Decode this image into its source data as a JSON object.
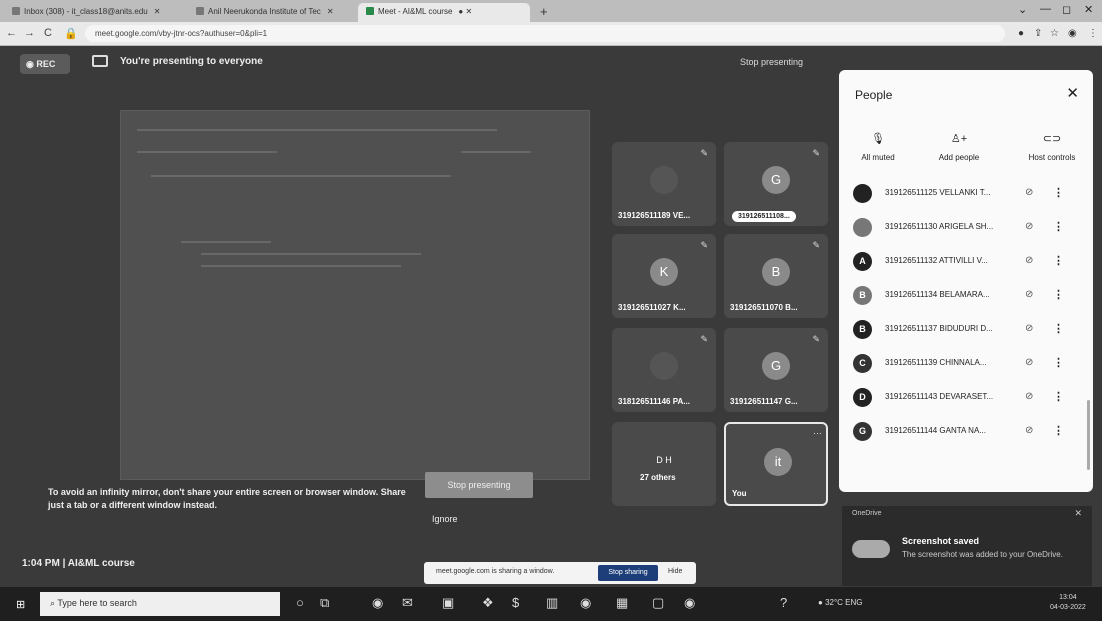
{
  "browser": {
    "tabs": [
      {
        "label": "Inbox (308) - it_class18@anits.edu"
      },
      {
        "label": "Anil Neerukonda Institute of Tec"
      },
      {
        "label": "Meet - AI&ML course"
      }
    ],
    "url": "meet.google.com/vby-jtnr-ocs?authuser=0&pli=1"
  },
  "meet": {
    "rec_label": "REC",
    "presenting_text": "You're presenting to everyone",
    "stop_presenting_top": "Stop presenting",
    "tiles": [
      {
        "name": "319126511189 VE...",
        "avatar": ""
      },
      {
        "name": "319126511108...",
        "avatar": "G"
      },
      {
        "name": "319126511027 K...",
        "avatar": "K"
      },
      {
        "name": "319126511070 B...",
        "avatar": "B"
      },
      {
        "name": "318126511146 PA...",
        "avatar": ""
      },
      {
        "name": "319126511147 G...",
        "avatar": "G"
      },
      {
        "name": "27 others",
        "avatar": "D H"
      },
      {
        "name": "You",
        "avatar": "it"
      }
    ],
    "mirror_warning": "To avoid an infinity mirror, don't share your entire screen or browser window. Share just a tab or a different window instead.",
    "stop_presenting_btn": "Stop presenting",
    "ignore_btn": "Ignore",
    "time_meeting": "1:04 PM  |  AI&ML course",
    "share_bar": {
      "message": "meet.google.com is sharing a window.",
      "stop_sharing": "Stop sharing",
      "hide": "Hide"
    }
  },
  "people_panel": {
    "title": "People",
    "actions": [
      {
        "label": "All muted",
        "icon": "mic-off-icon"
      },
      {
        "label": "Add people",
        "icon": "add-person-icon"
      },
      {
        "label": "Host controls",
        "icon": "toggle-icon"
      }
    ],
    "participants": [
      {
        "name": "319126511125 VELLANKI T...",
        "avatar": "",
        "color": "#222222"
      },
      {
        "name": "319126511130 ARIGELA SH...",
        "avatar": "",
        "color": "#666666"
      },
      {
        "name": "319126511132 ATTIVILLI V...",
        "avatar": "A",
        "color": "#111111"
      },
      {
        "name": "319126511134 BELAMARA...",
        "avatar": "B",
        "color": "#777777"
      },
      {
        "name": "319126511137 BIDUDURI D...",
        "avatar": "B",
        "color": "#111111"
      },
      {
        "name": "319126511139 CHINNALA...",
        "avatar": "C",
        "color": "#333333"
      },
      {
        "name": "319126511143 DEVARASET...",
        "avatar": "D",
        "color": "#111111"
      },
      {
        "name": "319126511144 GANTA NA...",
        "avatar": "G",
        "color": "#333333"
      }
    ]
  },
  "toast": {
    "app": "OneDrive",
    "title": "Screenshot saved",
    "body": "The screenshot was added to your OneDrive."
  },
  "taskbar": {
    "search_placeholder": "Type here to search",
    "tray": "32°C  ENG",
    "time": "13:04",
    "date": "04-03-2022"
  }
}
